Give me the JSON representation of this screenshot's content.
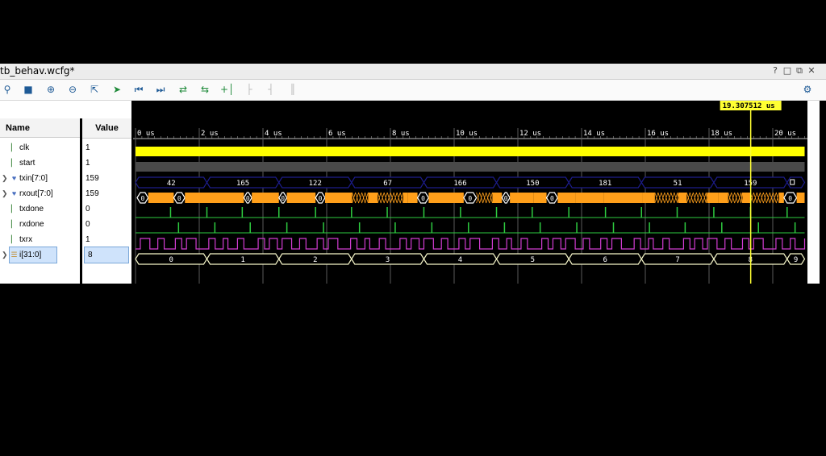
{
  "window": {
    "title": "tb_behav.wcfg*",
    "controls": [
      "?",
      "□",
      "⧉",
      "✕"
    ]
  },
  "toolbar": {
    "icons": [
      "search-icon",
      "save-icon",
      "zoom-in-icon",
      "zoom-out-icon",
      "zoom-fit-icon",
      "go-to-cursor-icon",
      "go-to-start-icon",
      "go-to-end-icon",
      "previous-transition-icon",
      "next-transition-icon",
      "add-marker-icon",
      "previous-marker-icon",
      "next-marker-icon",
      "swap-cursors-icon",
      "settings-icon"
    ]
  },
  "panel": {
    "name_header": "Name",
    "value_header": "Value"
  },
  "signals": [
    {
      "name": "clk",
      "value": "1",
      "icon": "bit-icon",
      "expandable": false
    },
    {
      "name": "start",
      "value": "1",
      "icon": "bit-icon",
      "expandable": false
    },
    {
      "name": "txin[7:0]",
      "value": "159",
      "icon": "bus-icon",
      "expandable": true
    },
    {
      "name": "rxout[7:0]",
      "value": "159",
      "icon": "bus-icon",
      "expandable": true
    },
    {
      "name": "txdone",
      "value": "0",
      "icon": "bit-icon",
      "expandable": false
    },
    {
      "name": "rxdone",
      "value": "0",
      "icon": "bit-icon",
      "expandable": false
    },
    {
      "name": "txrx",
      "value": "1",
      "icon": "bit-icon",
      "expandable": false
    },
    {
      "name": "i[31:0]",
      "value": "8",
      "icon": "int-bus-icon",
      "expandable": true,
      "selected": true
    }
  ],
  "timeline": {
    "cursor_label": "19.307512 us",
    "cursor_time_us": 19.307512,
    "visible_range_us": [
      0,
      21
    ],
    "ticks": [
      "0 us",
      "2 us",
      "4 us",
      "6 us",
      "8 us",
      "10 us",
      "12 us",
      "14 us",
      "16 us",
      "18 us",
      "20 us"
    ]
  },
  "bus_segments": {
    "txin": [
      "42",
      "165",
      "122",
      "67",
      "166",
      "150",
      "181",
      "51",
      "159",
      ""
    ],
    "i": [
      "0",
      "1",
      "2",
      "3",
      "4",
      "5",
      "6",
      "7",
      "8",
      "9"
    ]
  },
  "colors": {
    "clk": "#ffff00",
    "start": "#4a4a4a",
    "bus_outline": "#1c1c8a",
    "rxout_fill": "#ff9f1a",
    "pulse": "#2ecc40",
    "txrx": "#d23dd2",
    "i_outline": "#f5f5c8",
    "cursor": "#ffff33",
    "gridline": "#5a5a5a"
  }
}
